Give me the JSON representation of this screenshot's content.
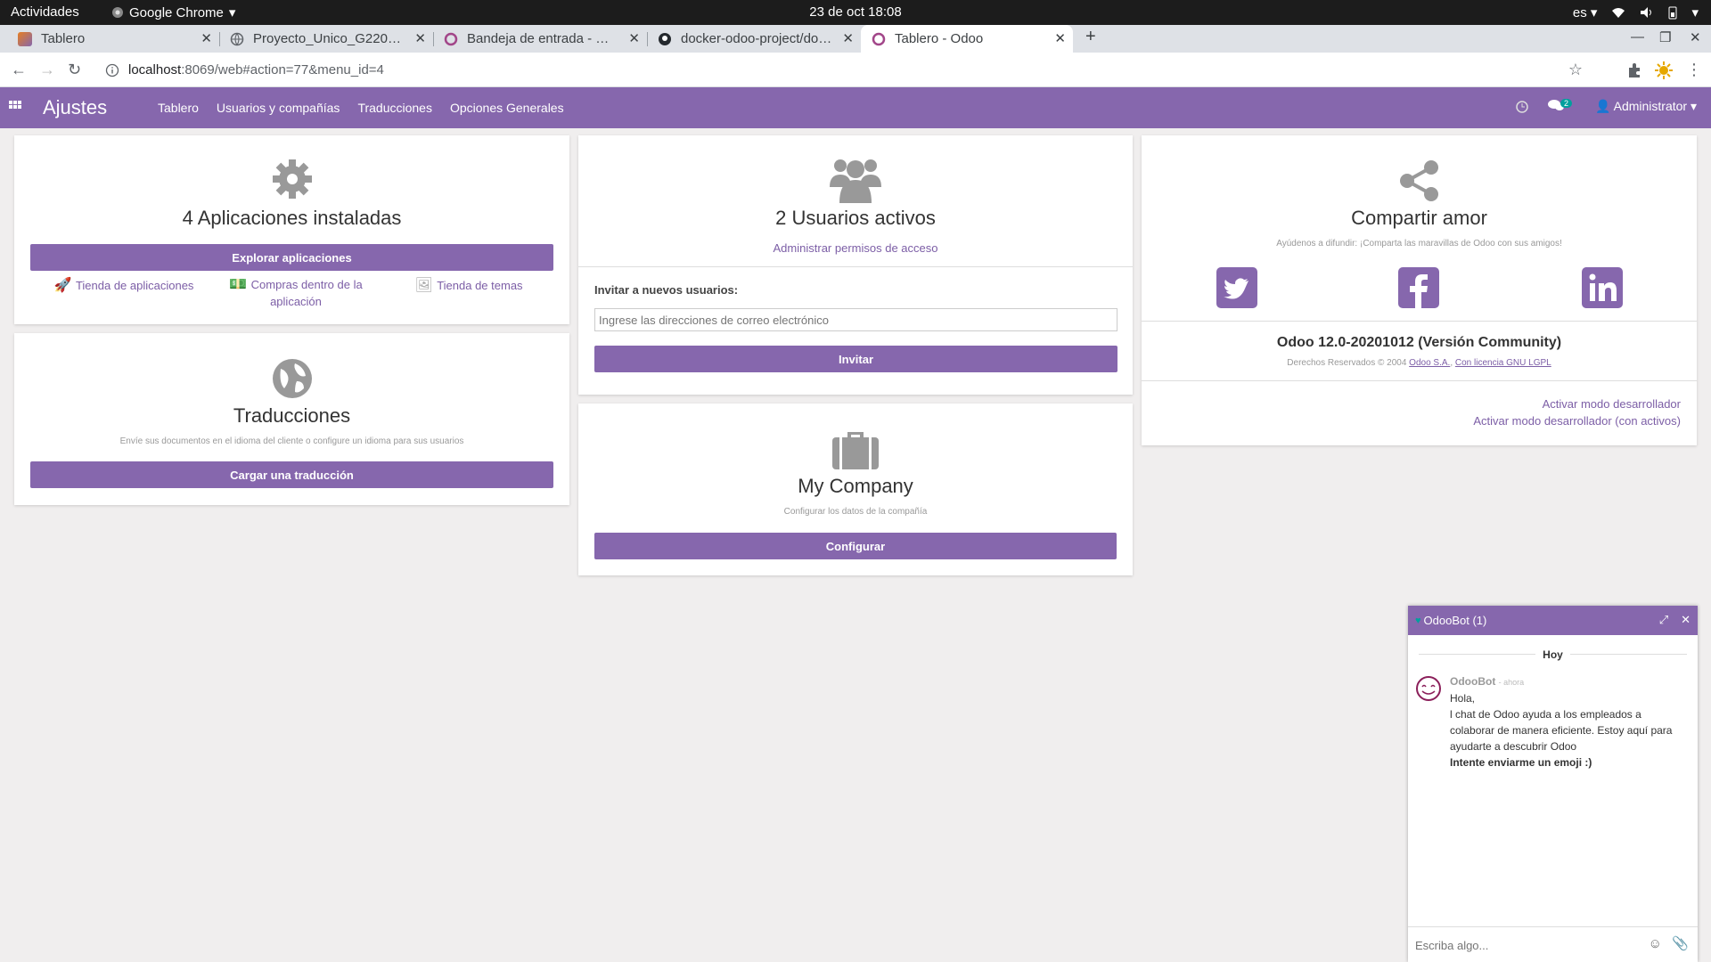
{
  "os": {
    "activities": "Actividades",
    "app": "Google Chrome",
    "clock": "23 de oct  18:08",
    "lang": "es"
  },
  "tabs": [
    {
      "title": "Tablero",
      "active": false
    },
    {
      "title": "Proyecto_Unico_G22020.pdf",
      "active": false
    },
    {
      "title": "Bandeja de entrada - Odoo",
      "active": false
    },
    {
      "title": "docker-odoo-project/docker",
      "active": false
    },
    {
      "title": "Tablero - Odoo",
      "active": true
    }
  ],
  "url": {
    "host": "localhost",
    "path": ":8069/web#action=77&menu_id=4"
  },
  "odoo": {
    "brand": "Ajustes",
    "menu": [
      "Tablero",
      "Usuarios y compañías",
      "Traducciones",
      "Opciones Generales"
    ],
    "messages_badge": "2",
    "user": "Administrator"
  },
  "apps_card": {
    "title": "4 Aplicaciones instaladas",
    "button": "Explorar aplicaciones",
    "links": [
      "Tienda de aplicaciones",
      "Compras dentro de la aplicación",
      "Tienda de temas"
    ]
  },
  "translations_card": {
    "title": "Traducciones",
    "subtitle": "Envíe sus documentos en el idioma del cliente o configure un idioma para sus usuarios",
    "button": "Cargar una traducción"
  },
  "users_card": {
    "title": "2 Usuarios activos",
    "link": "Administrar permisos de acceso",
    "invite_label": "Invitar a nuevos usuarios:",
    "invite_placeholder": "Ingrese las direcciones de correo electrónico",
    "button": "Invitar"
  },
  "company_card": {
    "title": "My Company",
    "subtitle": "Configurar los datos de la compañía",
    "button": "Configurar"
  },
  "share_card": {
    "title": "Compartir amor",
    "subtitle": "Ayúdenos a difundir: ¡Comparta las maravillas de Odoo con sus amigos!",
    "version": "Odoo 12.0-20201012 (Versión Community)",
    "copyright": "Derechos Reservados © 2004",
    "odoo_sa": "Odoo S.A.",
    "license": "Con licencia GNU LGPL",
    "dev_mode": "Activar modo desarrollador",
    "dev_mode_assets": "Activar modo desarrollador (con activos)",
    "colors": {
      "twitter": "#8667ad",
      "facebook": "#8667ad",
      "linkedin": "#8667ad"
    }
  },
  "chat": {
    "title": "OdooBot (1)",
    "day": "Hoy",
    "author": "OdooBot",
    "time": "- ahora",
    "greeting": "Hola,",
    "body": "l chat de Odoo ayuda a los empleados a colaborar de manera eficiente. Estoy aquí para ayudarte a descubrir Odoo",
    "bold": "Intente enviarme un emoji :)",
    "placeholder": "Escriba algo..."
  }
}
